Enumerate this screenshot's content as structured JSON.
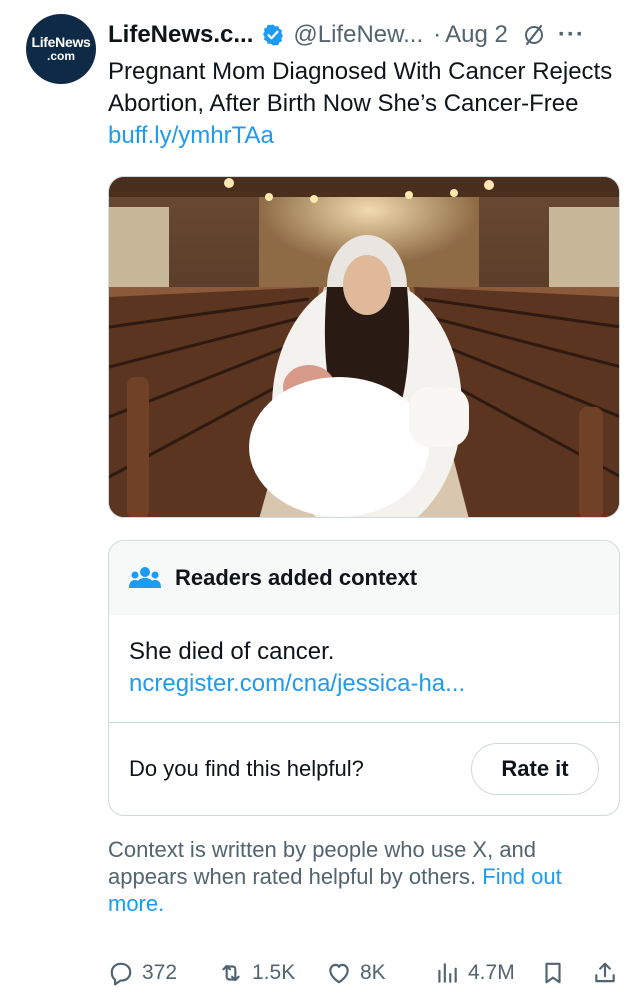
{
  "account": {
    "avatar_line1": "LifeNews",
    "avatar_line2": ".com",
    "name": "LifeNews.c...",
    "handle": "@LifeNew...",
    "separator": "·",
    "date": "Aug 2",
    "more": "···"
  },
  "tweet": {
    "text": "Pregnant Mom Diagnosed With Cancer Rejects Abortion, After Birth Now She’s Cancer-Free ",
    "link": "buff.ly/ymhrTAa"
  },
  "community_note": {
    "title": "Readers added context",
    "note": "She died of cancer.",
    "link": "ncregister.com/cna/jessica-ha...",
    "question": "Do you find this helpful?",
    "rate_label": "Rate it",
    "info_text": "Context is written by people who use X, and appears when rated helpful by others. ",
    "find_out_more": "Find out more."
  },
  "actions": {
    "replies": "372",
    "reposts": "1.5K",
    "likes": "8K",
    "views": "4.7M"
  },
  "colors": {
    "link": "#1d9bf0",
    "secondary_text": "#536471",
    "border": "#cfd9de",
    "verified": "#1d9bf0"
  }
}
